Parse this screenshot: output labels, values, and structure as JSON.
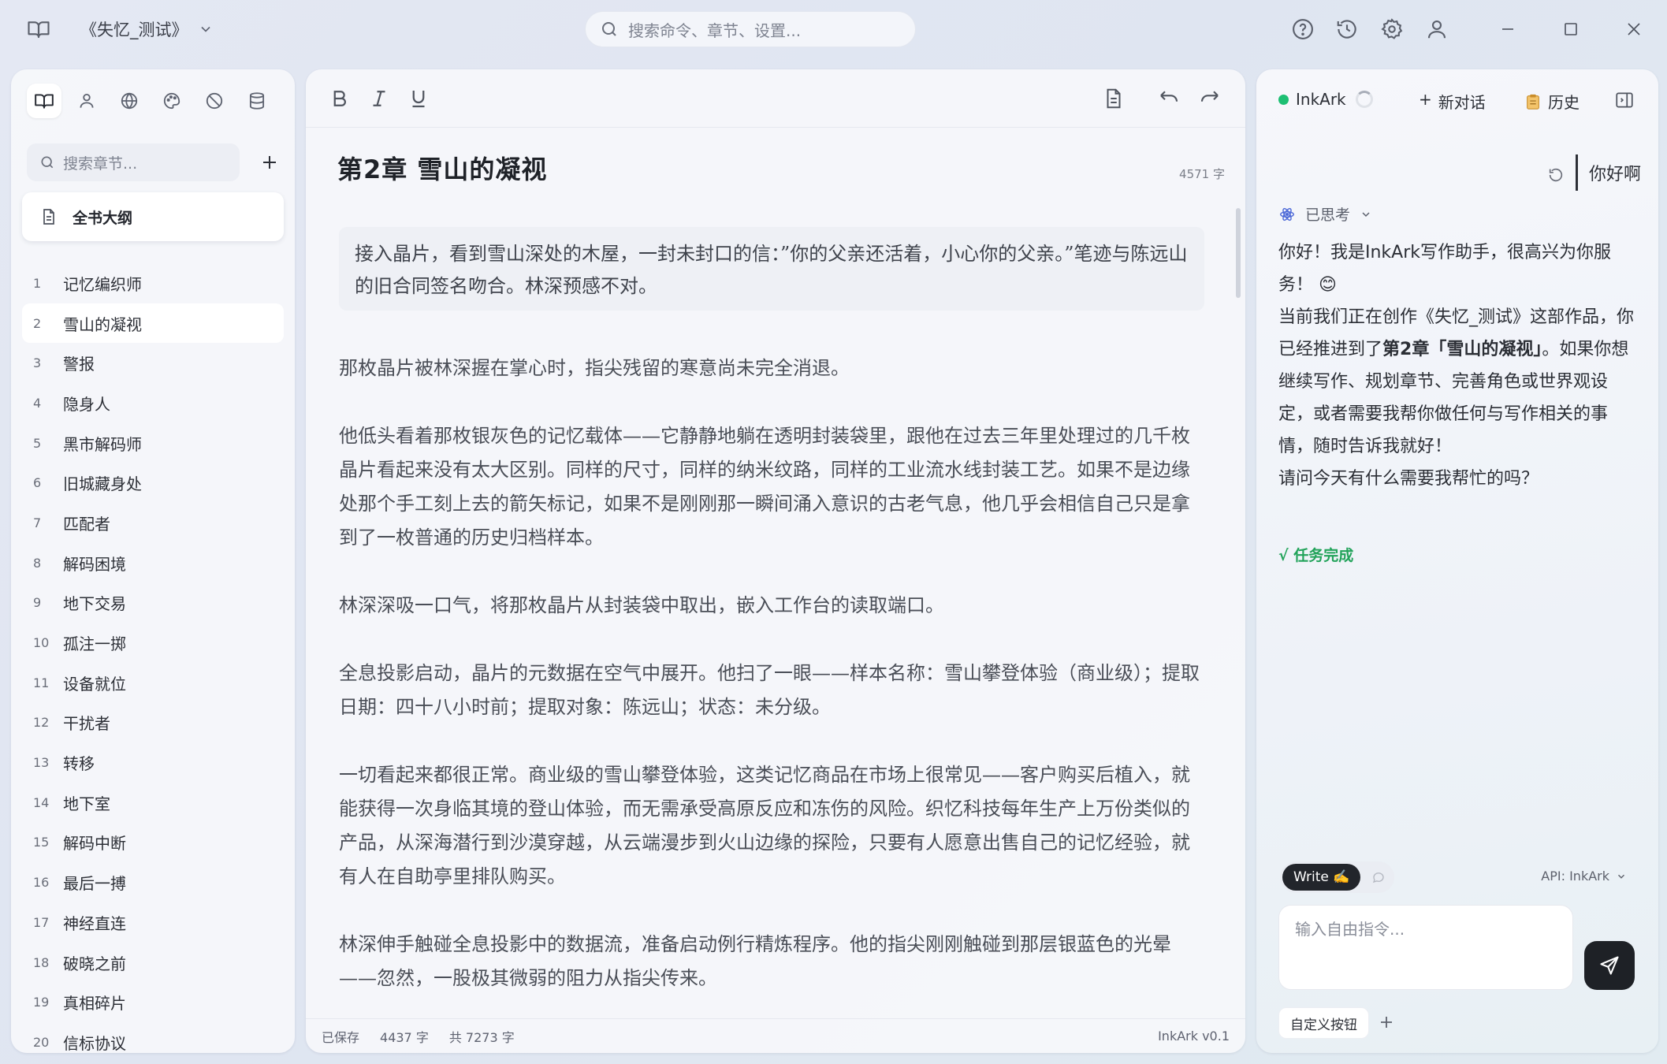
{
  "titlebar": {
    "book_title": "《失忆_测试》",
    "search_placeholder": "搜索命令、章节、设置..."
  },
  "left_panel": {
    "tabs": [
      "chapters",
      "characters",
      "world",
      "style",
      "forbidden",
      "database"
    ],
    "search_placeholder": "搜索章节...",
    "outline_label": "全书大纲",
    "chapters": [
      {
        "num": "1",
        "name": "记忆编织师"
      },
      {
        "num": "2",
        "name": "雪山的凝视"
      },
      {
        "num": "3",
        "name": "警报"
      },
      {
        "num": "4",
        "name": "隐身人"
      },
      {
        "num": "5",
        "name": "黑市解码师"
      },
      {
        "num": "6",
        "name": "旧城藏身处"
      },
      {
        "num": "7",
        "name": "匹配者"
      },
      {
        "num": "8",
        "name": "解码困境"
      },
      {
        "num": "9",
        "name": "地下交易"
      },
      {
        "num": "10",
        "name": "孤注一掷"
      },
      {
        "num": "11",
        "name": "设备就位"
      },
      {
        "num": "12",
        "name": "干扰者"
      },
      {
        "num": "13",
        "name": "转移"
      },
      {
        "num": "14",
        "name": "地下室"
      },
      {
        "num": "15",
        "name": "解码中断"
      },
      {
        "num": "16",
        "name": "最后一搏"
      },
      {
        "num": "17",
        "name": "神经直连"
      },
      {
        "num": "18",
        "name": "破晓之前"
      },
      {
        "num": "19",
        "name": "真相碎片"
      },
      {
        "num": "20",
        "name": "信标协议"
      }
    ],
    "active_chapter": "2"
  },
  "editor": {
    "chapter_title": "第2章  雪山的凝视",
    "word_count": "4571 字",
    "summary": "接入晶片，看到雪山深处的木屋，一封未封口的信：”你的父亲还活着，小心你的父亲。”笔迹与陈远山的旧合同签名吻合。林深预感不对。",
    "paragraphs": [
      "那枚晶片被林深握在掌心时，指尖残留的寒意尚未完全消退。",
      "他低头看着那枚银灰色的记忆载体——它静静地躺在透明封装袋里，跟他在过去三年里处理过的几千枚晶片看起来没有太大区别。同样的尺寸，同样的纳米纹路，同样的工业流水线封装工艺。如果不是边缘处那个手工刻上去的箭矢标记，如果不是刚刚那一瞬间涌入意识的古老气息，他几乎会相信自己只是拿到了一枚普通的历史归档样本。",
      "林深深吸一口气，将那枚晶片从封装袋中取出，嵌入工作台的读取端口。",
      "全息投影启动，晶片的元数据在空气中展开。他扫了一眼——样本名称：雪山攀登体验（商业级）；提取日期：四十八小时前；提取对象：陈远山；状态：未分级。",
      "一切看起来都很正常。商业级的雪山攀登体验，这类记忆商品在市场上很常见——客户购买后植入，就能获得一次身临其境的登山体验，而无需承受高原反应和冻伤的风险。织忆科技每年生产上万份类似的产品，从深海潜行到沙漠穿越，从云端漫步到火山边缘的探险，只要有人愿意出售自己的记忆经验，就有人在自助亭里排队购买。",
      "林深伸手触碰全息投影中的数据流，准备启动例行精炼程序。他的指尖刚刚触碰到那层银蓝色的光晕——忽然，一股极其微弱的阻力从指尖传来。"
    ],
    "status": {
      "saved": "已保存",
      "chapter_chars": "4437 字",
      "total_chars": "共 7273 字",
      "version": "InkArk v0.1"
    }
  },
  "ai_panel": {
    "assistant_name": "InkArk",
    "new_chat": "新对话",
    "history": "历史",
    "user_message": "你好啊",
    "thought_label": "已思考",
    "reply_1": "你好！我是InkArk写作助手，很高兴为你服务！ 😊",
    "reply_2_pre": "当前我们正在创作《失忆_测试》这部作品，你已经推进到了",
    "reply_2_bold": "第2章「雪山的凝视」",
    "reply_2_post": "。如果你想继续写作、规划章节、完善角色或世界观设定，或者需要我帮你做任何与写作相关的事情，随时告诉我就好！",
    "reply_3": "请问今天有什么需要我帮忙的吗？",
    "task_done": "√ 任务完成",
    "mode_write": "Write ✍️",
    "api_label": "API: InkArk",
    "input_placeholder": "输入自由指令...",
    "custom_button": "自定义按钮"
  },
  "colors": {
    "status_online": "#1dbf73",
    "task_done": "#22a35a",
    "send_button": "#1e2126"
  }
}
